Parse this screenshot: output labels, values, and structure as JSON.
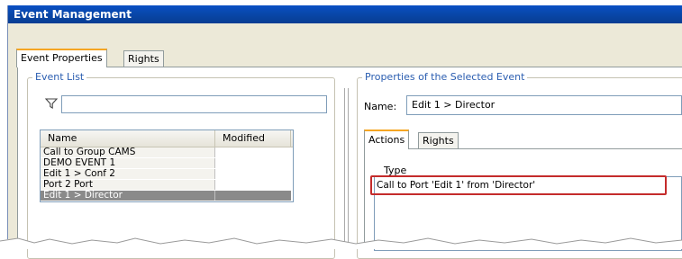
{
  "window": {
    "title": "Event Management"
  },
  "tabs": [
    {
      "label": "Event Properties",
      "active": true
    },
    {
      "label": "Rights",
      "active": false
    }
  ],
  "event_list": {
    "title": "Event List",
    "filter_value": "",
    "columns": [
      "Name",
      "Modified"
    ],
    "rows": [
      {
        "name": "Call to Group CAMS",
        "modified": ""
      },
      {
        "name": "DEMO EVENT 1",
        "modified": ""
      },
      {
        "name": "Edit 1 > Conf 2",
        "modified": ""
      },
      {
        "name": "Port 2 Port",
        "modified": ""
      },
      {
        "name": "Edit 1 > Director",
        "modified": "",
        "selected": true
      }
    ]
  },
  "properties": {
    "title": "Properties of the Selected Event",
    "name_label": "Name:",
    "name_value": "Edit 1 > Director",
    "tabs": [
      {
        "label": "Actions",
        "active": true
      },
      {
        "label": "Rights",
        "active": false
      }
    ],
    "actions": {
      "column": "Type",
      "rows": [
        {
          "type": "Call to Port 'Edit 1' from 'Director'",
          "highlighted": true
        }
      ]
    }
  },
  "colors": {
    "title_bar": "#0a4fc4",
    "group_title": "#2a5db0",
    "selection": "#8a8a8a",
    "highlight_border": "#c42b2b",
    "active_tab_accent": "#f5a623"
  }
}
